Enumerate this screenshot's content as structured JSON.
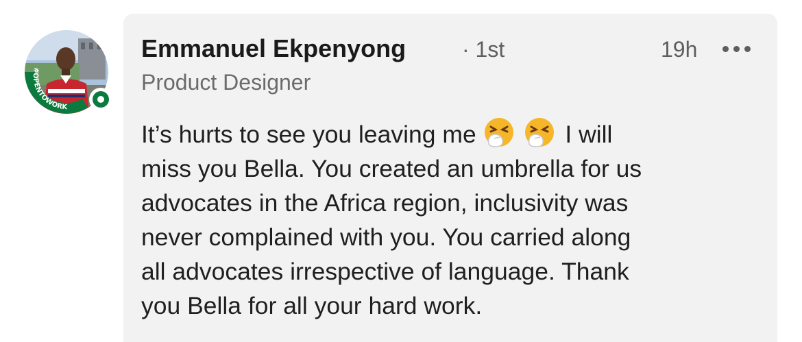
{
  "author": {
    "name": "Emmanuel Ekpenyong",
    "degree": "· 1st",
    "headline": "Product Designer",
    "avatar_badge_text": "#OPENTOWORK"
  },
  "comment": {
    "time": "19h",
    "lines": [
      "It’s hurts to see you leaving me",
      "I will",
      "miss you Bella. You created an umbrella for us",
      "advocates in the Africa region, inclusivity was",
      "never complained with you. You carried along",
      "all advocates irrespective of language. Thank",
      "you Bella for all your hard work."
    ],
    "emojis": [
      "sneezing-face-emoji",
      "sneezing-face-emoji"
    ]
  },
  "colors": {
    "bubble": "#f2f2f2",
    "open_to_work": "#0b7a3e",
    "muted_text": "#5e5e5e"
  }
}
